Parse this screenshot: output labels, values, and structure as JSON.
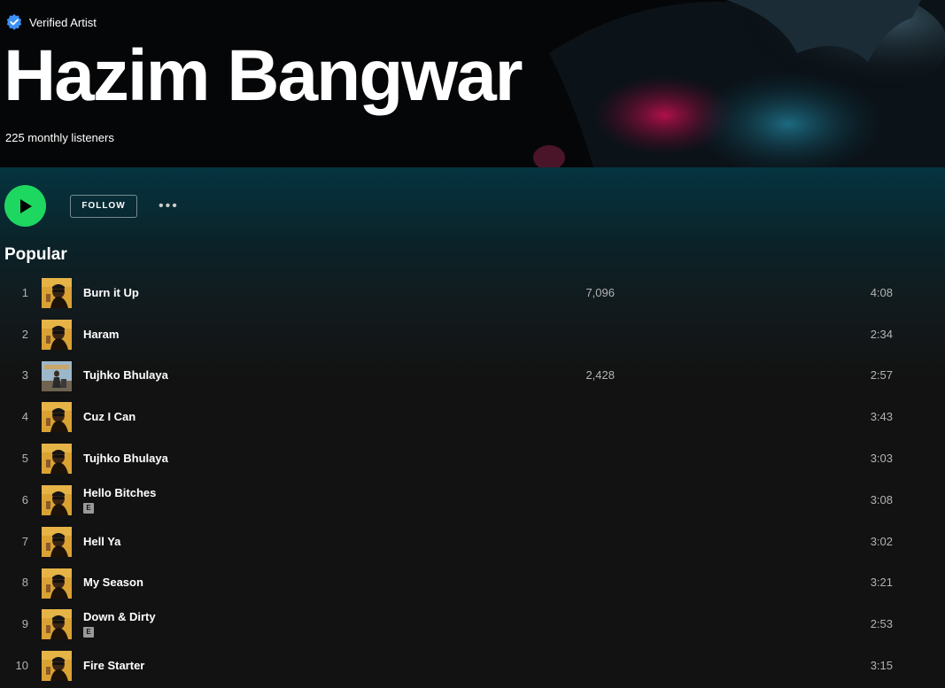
{
  "artist": {
    "verified_label": "Verified Artist",
    "name": "Hazim Bangwar",
    "monthly_listeners": "225 monthly listeners"
  },
  "actions": {
    "play_icon": "play-icon",
    "follow_label": "FOLLOW",
    "more_label": "•••"
  },
  "popular": {
    "title": "Popular",
    "tracks": [
      {
        "num": "1",
        "title": "Burn it Up",
        "plays": "7,096",
        "duration": "4:08",
        "explicit": false,
        "art": "orange"
      },
      {
        "num": "2",
        "title": "Haram",
        "plays": "",
        "duration": "2:34",
        "explicit": false,
        "art": "orange"
      },
      {
        "num": "3",
        "title": "Tujhko Bhulaya",
        "plays": "2,428",
        "duration": "2:57",
        "explicit": false,
        "art": "sky"
      },
      {
        "num": "4",
        "title": "Cuz I Can",
        "plays": "",
        "duration": "3:43",
        "explicit": false,
        "art": "orange"
      },
      {
        "num": "5",
        "title": "Tujhko Bhulaya",
        "plays": "",
        "duration": "3:03",
        "explicit": false,
        "art": "orange"
      },
      {
        "num": "6",
        "title": "Hello Bitches",
        "plays": "",
        "duration": "3:08",
        "explicit": true,
        "art": "orange"
      },
      {
        "num": "7",
        "title": "Hell Ya",
        "plays": "",
        "duration": "3:02",
        "explicit": false,
        "art": "orange"
      },
      {
        "num": "8",
        "title": "My Season",
        "plays": "",
        "duration": "3:21",
        "explicit": false,
        "art": "orange"
      },
      {
        "num": "9",
        "title": "Down & Dirty",
        "plays": "",
        "duration": "2:53",
        "explicit": true,
        "art": "orange"
      },
      {
        "num": "10",
        "title": "Fire Starter",
        "plays": "",
        "duration": "3:15",
        "explicit": false,
        "art": "orange"
      }
    ],
    "explicit_label": "E"
  },
  "colors": {
    "accent_green": "#1ed760",
    "background": "#121212",
    "gradient_top": "#053440",
    "muted_text": "#b3b3b3"
  }
}
